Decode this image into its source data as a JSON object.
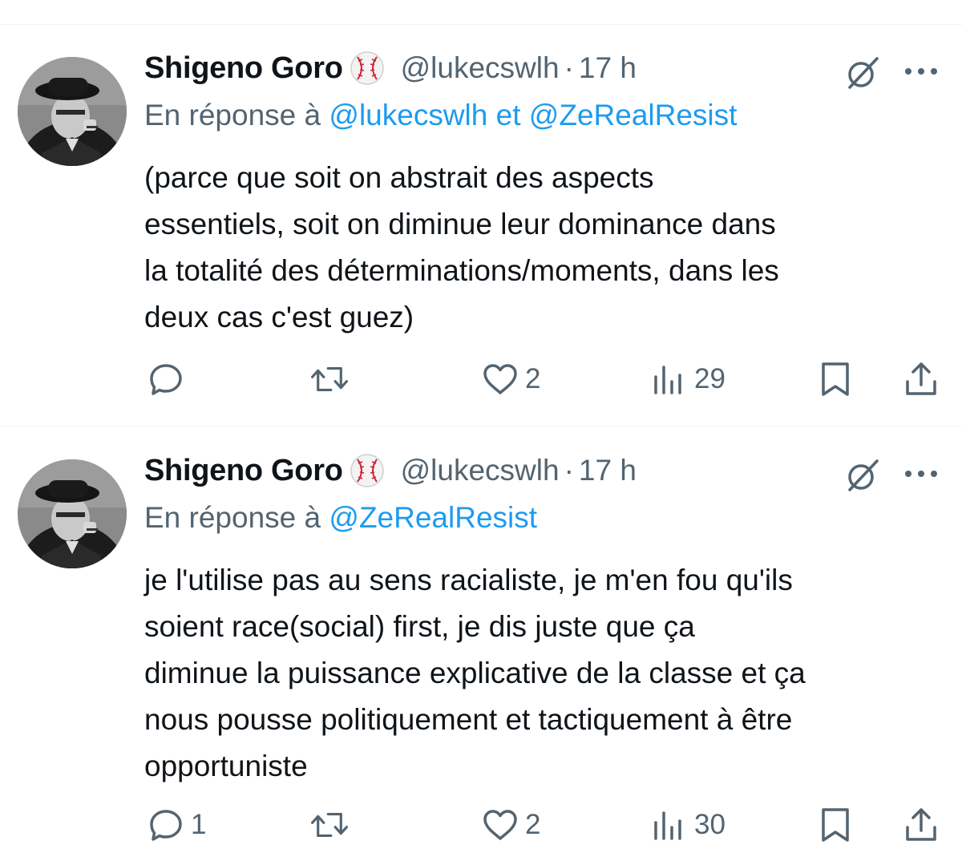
{
  "tweets": [
    {
      "author_name": "Shigeno Goro",
      "author_badge_icon": "baseball-emoji",
      "handle": "@lukecswlh",
      "separator": "·",
      "time": "17 h",
      "reply_prefix": "En réponse à",
      "reply_mentions": [
        "@lukecswlh",
        "@ZeRealResist"
      ],
      "reply_joiner": "et",
      "body_lines": [
        "(parce que soit on abstrait des aspects",
        "essentiels, soit on diminue leur dominance dans",
        "la totalité des déterminations/moments, dans les",
        "deux cas c'est guez)"
      ],
      "stats": {
        "replies": "",
        "retweets": "",
        "likes": "2",
        "views": "29"
      }
    },
    {
      "author_name": "Shigeno Goro",
      "author_badge_icon": "baseball-emoji",
      "handle": "@lukecswlh",
      "separator": "·",
      "time": "17 h",
      "reply_prefix": "En réponse à",
      "reply_mentions": [
        "@ZeRealResist"
      ],
      "reply_joiner": "",
      "body_lines": [
        "je l'utilise pas au sens racialiste, je m'en fou qu'ils",
        "soient race(social) first, je dis juste que ça",
        "diminue la puissance explicative de la classe et ça",
        "nous pousse politiquement et tactiquement à être",
        "opportuniste"
      ],
      "stats": {
        "replies": "1",
        "retweets": "",
        "likes": "2",
        "views": "30"
      }
    }
  ],
  "icons": [
    "reply-icon",
    "retweet-icon",
    "like-icon",
    "views-icon",
    "bookmark-icon",
    "share-icon",
    "grok-icon",
    "more-icon"
  ],
  "colors": {
    "text": "#0f1419",
    "secondary": "#536471",
    "link": "#1d9bf0",
    "divider": "#eff3f4"
  }
}
